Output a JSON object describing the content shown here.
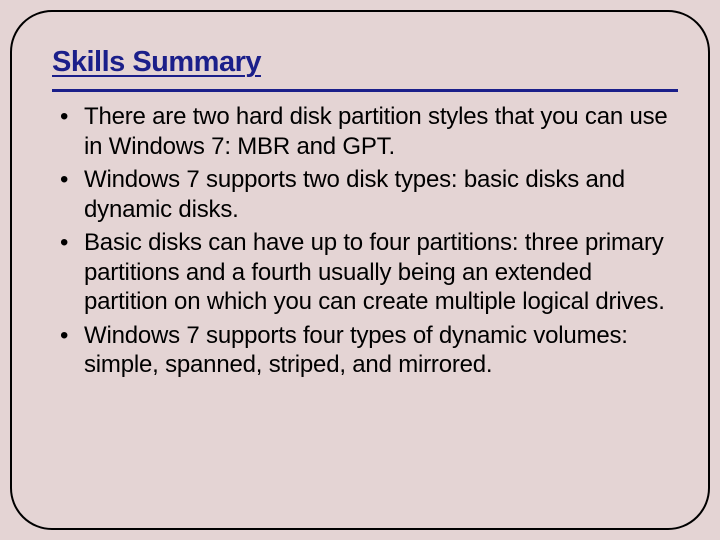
{
  "slide": {
    "title": "Skills Summary",
    "bullets": [
      "There are two hard disk partition styles that you can use in Windows 7: MBR and GPT.",
      "Windows 7 supports two disk types: basic disks and dynamic disks.",
      "Basic disks can have up to four partitions: three primary partitions and a fourth usually being an extended partition on which you can create multiple logical drives.",
      "Windows 7 supports four types of dynamic volumes: simple, spanned, striped, and mirrored."
    ]
  }
}
